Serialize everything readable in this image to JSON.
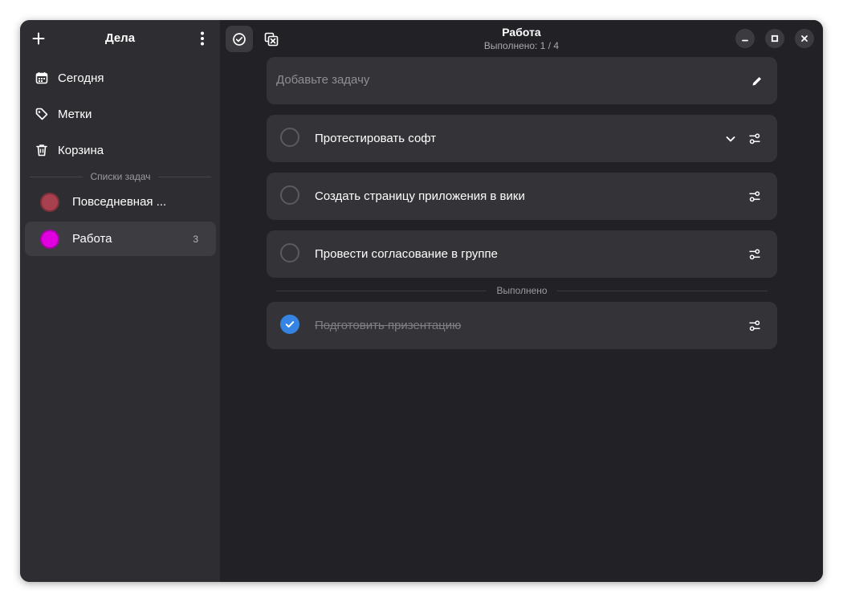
{
  "sidebar": {
    "title": "Дела",
    "nav": [
      {
        "label": "Сегодня",
        "icon": "calendar-icon"
      },
      {
        "label": "Метки",
        "icon": "tag-icon"
      },
      {
        "label": "Корзина",
        "icon": "trash-icon"
      }
    ],
    "lists_header": "Списки задач",
    "lists": [
      {
        "label": "Повседневная ...",
        "color": "#a8404f",
        "count": ""
      },
      {
        "label": "Работа",
        "color": "#e000e0",
        "count": "3"
      }
    ]
  },
  "header": {
    "title": "Работа",
    "subtitle": "Выполнено: 1 / 4"
  },
  "add_task": {
    "placeholder": "Добавьте задачу"
  },
  "tasks": [
    {
      "text": "Протестировать софт",
      "done": false
    },
    {
      "text": "Создать страницу приложения в вики",
      "done": false
    },
    {
      "text": "Провести согласование в группе",
      "done": false
    }
  ],
  "completed_header": "Выполнено",
  "completed": [
    {
      "text": "Подготовить призентацию",
      "done": true
    }
  ],
  "colors": {
    "accent": "#3584e4",
    "window_bg": "#222226",
    "sidebar_bg": "#2e2e32",
    "card_bg": "#343438"
  }
}
